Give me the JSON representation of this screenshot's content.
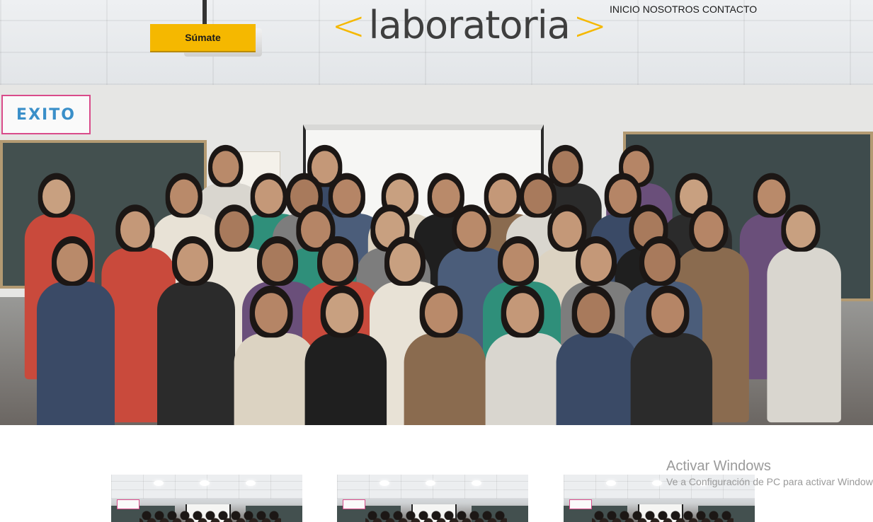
{
  "header": {
    "join_label": "Súmate",
    "logo": {
      "open_bracket": "<",
      "word": "laboratoria",
      "close_bracket": ">",
      "bracket_color": "#f5b800",
      "word_color": "#3e3e3e"
    },
    "nav": [
      {
        "label": "INICIO"
      },
      {
        "label": "NOSOTROS"
      },
      {
        "label": "CONTACTO"
      }
    ]
  },
  "hero": {
    "sign_text": "EXITO"
  },
  "gallery": {
    "thumbnails": [
      {
        "sign_text": "éxito"
      },
      {
        "sign_text": "éxito"
      },
      {
        "sign_text": "éxito"
      }
    ]
  },
  "watermark": {
    "title": "Activar Windows",
    "subtitle": "Ve a Configuración de PC para activar Windows."
  },
  "colors": {
    "accent": "#f5b800",
    "text": "#1a1a1a"
  }
}
